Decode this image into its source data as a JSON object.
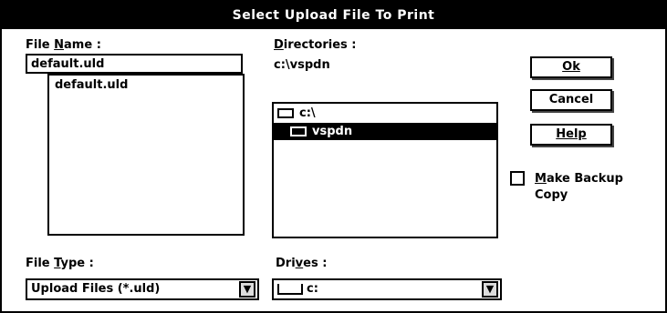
{
  "dialog": {
    "title": "Select Upload File To Print"
  },
  "file_name": {
    "label_pre": "File ",
    "label_u": "N",
    "label_post": "ame :",
    "value": "default.uld",
    "list": [
      "default.uld"
    ]
  },
  "directories": {
    "label_u": "D",
    "label_post": "irectories :",
    "current_path": "c:\\vspdn",
    "items": [
      "c:\\",
      "vspdn"
    ],
    "selected": "vspdn"
  },
  "buttons": {
    "ok": "Ok",
    "cancel": "Cancel",
    "help": "Help"
  },
  "backup": {
    "label_u": "M",
    "label_post": "ake Backup",
    "label_line2": "Copy",
    "checked": false
  },
  "file_type": {
    "label_pre": "File ",
    "label_u": "T",
    "label_post": "ype :",
    "value": "Upload Files (*.uld)"
  },
  "drives": {
    "label_pre": "Dri",
    "label_u": "v",
    "label_post": "es :",
    "value": "c:"
  },
  "icons": {
    "folder": "folder-icon",
    "drive": "drive-icon",
    "dropdown": "dropdown-arrow-icon"
  }
}
